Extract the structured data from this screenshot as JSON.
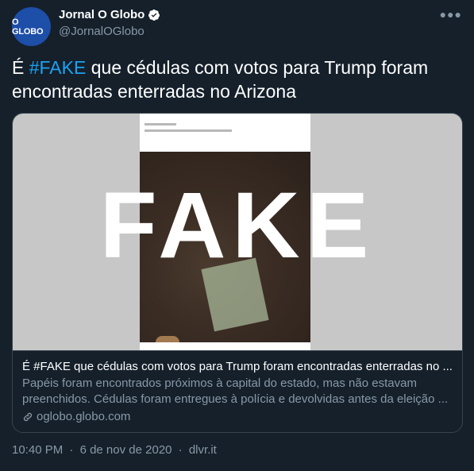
{
  "author": {
    "avatar_text": "O GLOBO",
    "name": "Jornal O Globo",
    "handle": "@JornalOGlobo",
    "verified": true
  },
  "tweet": {
    "text_prefix": "É ",
    "hashtag": "#FAKE",
    "text_rest": " que cédulas com votos para Trump foram encontradas enterradas no Arizona"
  },
  "card": {
    "image_overlay_text": "FAKE",
    "title": "É #FAKE que cédulas com votos para Trump foram encontradas enterradas no ...",
    "description": "Papéis foram encontrados próximos à capital do estado, mas não estavam preenchidos. Cédulas foram entregues à polícia e devolvidas antes da eleição ...",
    "domain": "oglobo.globo.com"
  },
  "meta": {
    "time": "10:40 PM",
    "date": "6 de nov de 2020",
    "source": "dlvr.it",
    "separator": "·"
  },
  "icons": {
    "more": "more-horizontal-icon",
    "verified": "verified-badge-icon",
    "link": "link-icon"
  },
  "colors": {
    "background": "#15202b",
    "accent": "#1da1f2",
    "muted": "#8899a6",
    "avatar": "#1d4ea8"
  }
}
